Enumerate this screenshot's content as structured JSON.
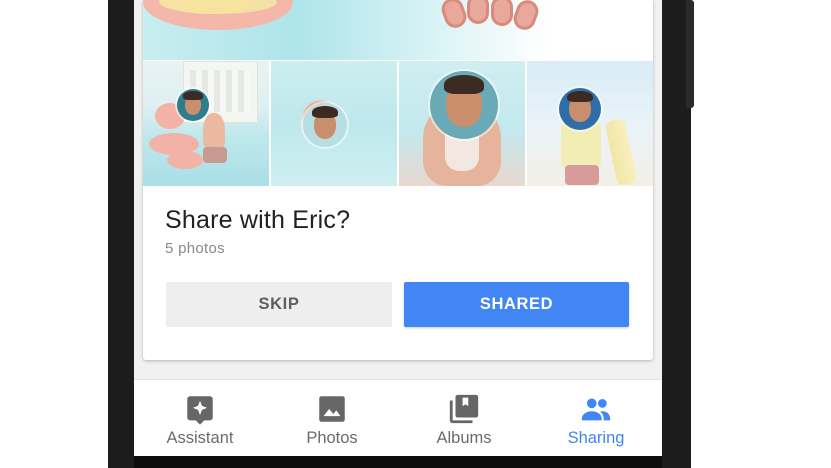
{
  "card": {
    "title": "Share with Eric?",
    "subtitle": "5 photos",
    "skip_label": "SKIP",
    "shared_label": "SHARED"
  },
  "nav": {
    "items": [
      {
        "label": "Assistant",
        "icon": "assistant-icon",
        "active": false
      },
      {
        "label": "Photos",
        "icon": "photos-icon",
        "active": false
      },
      {
        "label": "Albums",
        "icon": "albums-icon",
        "active": false
      },
      {
        "label": "Sharing",
        "icon": "sharing-icon",
        "active": true
      }
    ]
  },
  "colors": {
    "accent": "#4285f4",
    "nav_inactive": "#6b6b6b",
    "title_text": "#212121",
    "subtitle_text": "#8a8a8a"
  }
}
